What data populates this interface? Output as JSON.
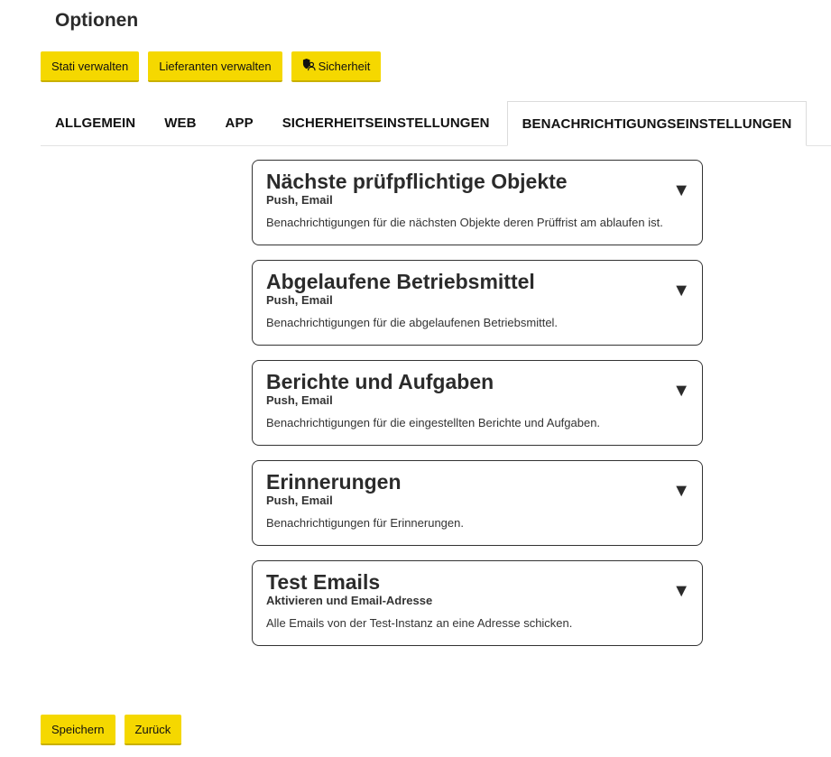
{
  "page": {
    "title": "Optionen"
  },
  "top_actions": {
    "stati": "Stati verwalten",
    "lieferanten": "Lieferanten verwalten",
    "sicherheit": "Sicherheit"
  },
  "tabs": [
    {
      "label": "ALLGEMEIN"
    },
    {
      "label": "WEB"
    },
    {
      "label": "APP"
    },
    {
      "label": "SICHERHEITSEINSTELLUNGEN"
    },
    {
      "label": "BENACHRICHTIGUNGSEINSTELLUNGEN",
      "active": true
    }
  ],
  "cards": [
    {
      "title": "Nächste prüfpflichtige Objekte",
      "subtitle": "Push, Email",
      "description": "Benachrichtigungen für die nächsten Objekte deren Prüffrist am ablaufen ist.",
      "arrow": "▼"
    },
    {
      "title": "Abgelaufene Betriebsmittel",
      "subtitle": "Push, Email",
      "description": "Benachrichtigungen für die abgelaufenen Betriebsmittel.",
      "arrow": "▼"
    },
    {
      "title": "Berichte und Aufgaben",
      "subtitle": "Push, Email",
      "description": "Benachrichtigungen für die eingestellten Berichte und Aufgaben.",
      "arrow": "▼"
    },
    {
      "title": "Erinnerungen",
      "subtitle": "Push, Email",
      "description": "Benachrichtigungen für Erinnerungen.",
      "arrow": "▼"
    },
    {
      "title": "Test Emails",
      "subtitle": "Aktivieren und Email-Adresse",
      "description": "Alle Emails von der Test-Instanz an eine Adresse schicken.",
      "arrow": "▼"
    }
  ],
  "bottom_actions": {
    "save": "Speichern",
    "back": "Zurück"
  },
  "colors": {
    "accent": "#f5d800",
    "text": "#2b2b2b",
    "border": "#333333"
  },
  "icons": {
    "sicherheit": "shield-person-icon",
    "expand": "triangle-down-icon"
  }
}
